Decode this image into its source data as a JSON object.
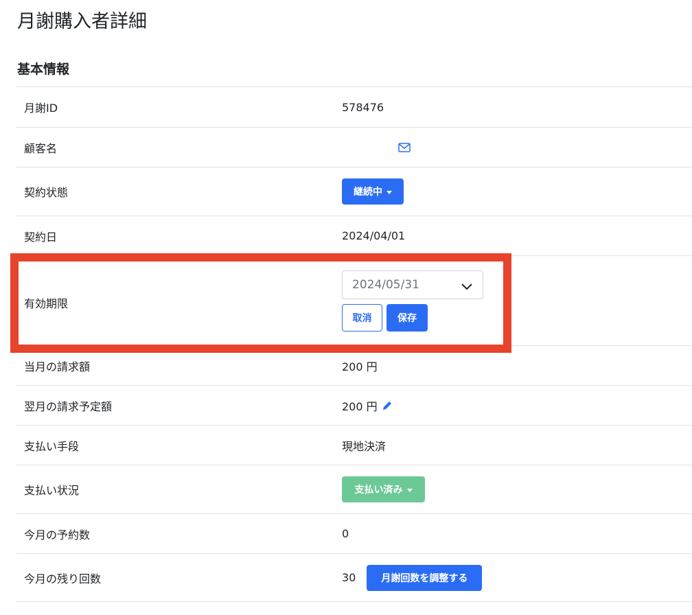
{
  "page": {
    "title": "月謝購入者詳細",
    "section_title": "基本情報"
  },
  "rows": {
    "monthly_id": {
      "label": "月謝ID",
      "value": "578476"
    },
    "customer_name": {
      "label": "顧客名",
      "icon": "envelope-icon"
    },
    "contract_status": {
      "label": "契約状態",
      "button_label": "継続中"
    },
    "contract_date": {
      "label": "契約日",
      "value": "2024/04/01"
    },
    "expiry": {
      "label": "有効期限",
      "select_value": "2024/05/31",
      "cancel_label": "取消",
      "save_label": "保存"
    },
    "current_billing": {
      "label": "当月の請求額",
      "value": "200 円"
    },
    "next_billing": {
      "label": "翌月の請求予定額",
      "value": "200 円",
      "icon": "pencil-icon"
    },
    "payment_method": {
      "label": "支払い手段",
      "value": "現地決済"
    },
    "payment_status": {
      "label": "支払い状況",
      "button_label": "支払い済み"
    },
    "reservations": {
      "label": "今月の予約数",
      "value": "0"
    },
    "remaining": {
      "label": "今月の残り回数",
      "value": "30",
      "button_label": "月謝回数を調整する"
    }
  },
  "colors": {
    "primary": "#2a6df4",
    "success": "#6cc996",
    "highlight": "#e8432c",
    "border": "#dee2e6"
  }
}
